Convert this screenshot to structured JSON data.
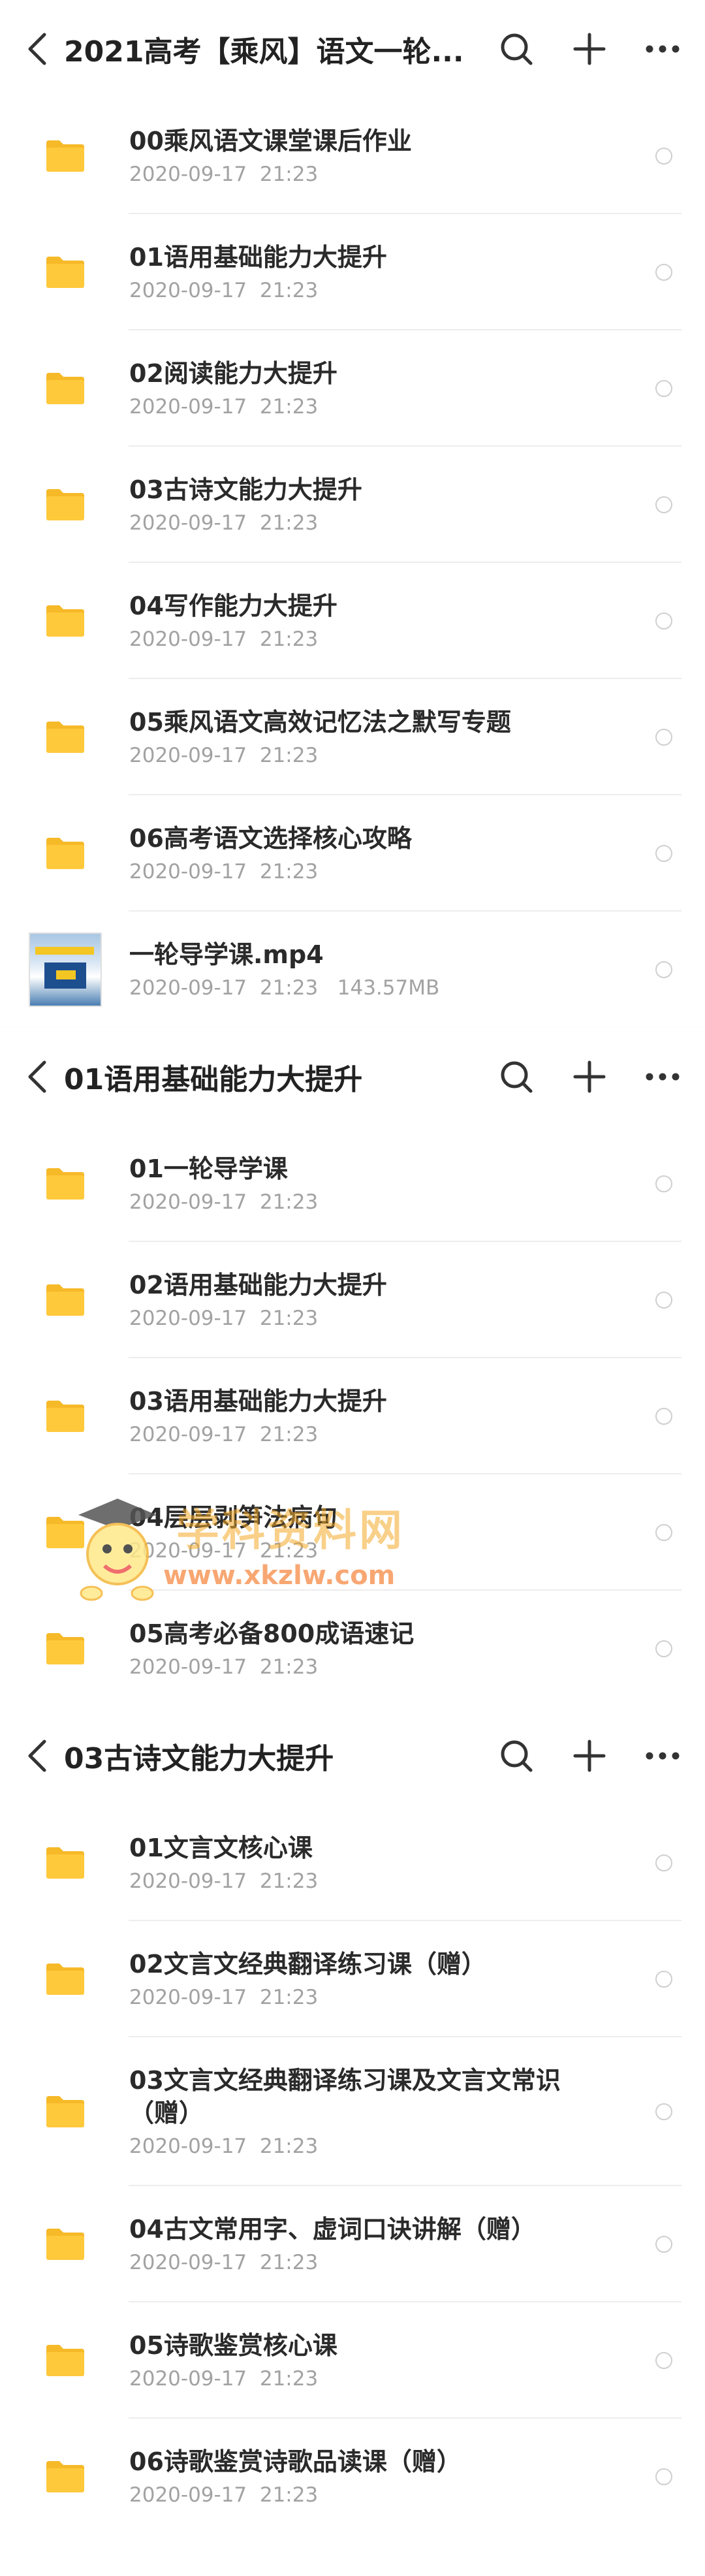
{
  "colors": {
    "folder": "#FFC93C",
    "folder_tab": "#F6B928",
    "title_text": "#222222",
    "meta_text": "#A2A2A2",
    "divider": "#EDEDED"
  },
  "panels": [
    {
      "title": "2021高考【乘风】语文一轮...",
      "icons": [
        "back-icon",
        "search-icon",
        "plus-icon",
        "more-icon"
      ],
      "items": [
        {
          "type": "folder",
          "name": "00乘风语文课堂课后作业",
          "date": "2020-09-17  21:23",
          "size": ""
        },
        {
          "type": "folder",
          "name": "01语用基础能力大提升",
          "date": "2020-09-17  21:23",
          "size": ""
        },
        {
          "type": "folder",
          "name": "02阅读能力大提升",
          "date": "2020-09-17  21:23",
          "size": ""
        },
        {
          "type": "folder",
          "name": "03古诗文能力大提升",
          "date": "2020-09-17  21:23",
          "size": ""
        },
        {
          "type": "folder",
          "name": "04写作能力大提升",
          "date": "2020-09-17  21:23",
          "size": ""
        },
        {
          "type": "folder",
          "name": "05乘风语文高效记忆法之默写专题",
          "date": "2020-09-17  21:23",
          "size": ""
        },
        {
          "type": "folder",
          "name": "06高考语文选择核心攻略",
          "date": "2020-09-17  21:23",
          "size": ""
        },
        {
          "type": "video",
          "name": "一轮导学课.mp4",
          "date": "2020-09-17  21:23",
          "size": "143.57MB"
        }
      ]
    },
    {
      "title": "01语用基础能力大提升",
      "icons": [
        "back-icon",
        "search-icon",
        "plus-icon",
        "more-icon"
      ],
      "items": [
        {
          "type": "folder",
          "name": "01一轮导学课",
          "date": "2020-09-17  21:23",
          "size": ""
        },
        {
          "type": "folder",
          "name": "02语用基础能力大提升",
          "date": "2020-09-17  21:23",
          "size": ""
        },
        {
          "type": "folder",
          "name": "03语用基础能力大提升",
          "date": "2020-09-17  21:23",
          "size": ""
        },
        {
          "type": "folder",
          "name": "04层层剥笋法病句",
          "date": "2020-09-17  21:23",
          "size": ""
        },
        {
          "type": "folder",
          "name": "05高考必备800成语速记",
          "date": "2020-09-17  21:23",
          "size": ""
        }
      ]
    },
    {
      "title": "03古诗文能力大提升",
      "icons": [
        "back-icon",
        "search-icon",
        "plus-icon",
        "more-icon"
      ],
      "items": [
        {
          "type": "folder",
          "name": "01文言文核心课",
          "date": "2020-09-17  21:23",
          "size": ""
        },
        {
          "type": "folder",
          "name": "02文言文经典翻译练习课（赠）",
          "date": "2020-09-17  21:23",
          "size": ""
        },
        {
          "type": "folder",
          "name": "03文言文经典翻译练习课及文言文常识（赠）",
          "date": "2020-09-17  21:23",
          "size": "",
          "tall": true
        },
        {
          "type": "folder",
          "name": "04古文常用字、虚词口诀讲解（赠）",
          "date": "2020-09-17  21:23",
          "size": ""
        },
        {
          "type": "folder",
          "name": "05诗歌鉴赏核心课",
          "date": "2020-09-17  21:23",
          "size": ""
        },
        {
          "type": "folder",
          "name": "06诗歌鉴赏诗歌品读课（赠）",
          "date": "2020-09-17  21:23",
          "size": ""
        }
      ]
    }
  ],
  "watermark": {
    "text": "学科资料网",
    "url": "www.xkzlw.com"
  }
}
